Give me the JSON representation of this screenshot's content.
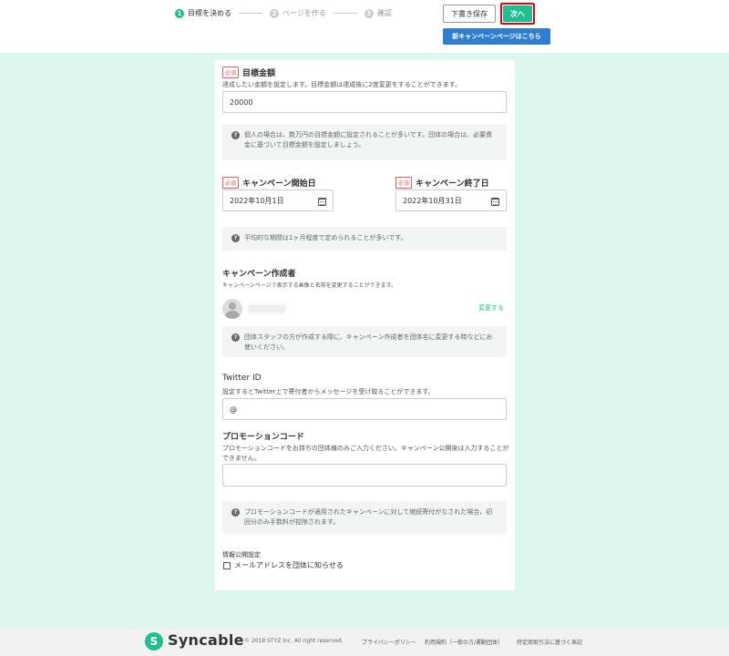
{
  "header": {
    "steps": [
      {
        "num": "1",
        "label": "目標を決める"
      },
      {
        "num": "2",
        "label": "ページを作る"
      },
      {
        "num": "3",
        "label": "確認"
      }
    ],
    "draft_label": "下書き保存",
    "next_label": "次へ",
    "new_campaign_label": "新キャンペーンページはこちら"
  },
  "form": {
    "required_badge": "必須",
    "goal": {
      "label": "目標金額",
      "description": "達成したい金額を設定します。目標金額は達成後に2度変更をすることができます。",
      "value": "20000",
      "hint": "個人の場合は、数万円の目標金額に設定されることが多いです。団体の場合は、必要資金に基づいて目標金額を設定しましょう。"
    },
    "start_date": {
      "label": "キャンペーン開始日",
      "value": "2022年10月1日"
    },
    "end_date": {
      "label": "キャンペーン終了日",
      "value": "2022年10月31日"
    },
    "period_hint": "平均的な期間は1ヶ月程度で定められることが多いです。",
    "creator": {
      "title": "キャンペーン作成者",
      "description": "キャンペーンページで表示する画像と名前を変更することができます。",
      "change_link": "変更する",
      "hint": "団体スタッフの方が作成する際に、キャンペーン作成者を団体名に変更する時などにお使いください。"
    },
    "twitter": {
      "title": "Twitter ID",
      "description": "設定するとTwitter上で寄付者からメッセージを受け取ることができます。",
      "value": "@"
    },
    "promo": {
      "title": "プロモーションコード",
      "description": "プロモーションコードをお持ちの団体様のみご入力ください。キャンペーン公開後は入力することができません。",
      "value": "",
      "hint": "プロモーションコードが適用されたキャンペーンに対して継続寄付がなされた場合、初回分のみ手数料が控除されます。"
    },
    "privacy": {
      "title": "情報公開設定",
      "checkbox_label": "メールアドレスを団体に知らせる",
      "checked": false
    }
  },
  "footer": {
    "logo_mark": "S",
    "logo_text": "Syncable",
    "copyright": "© 2018 STYZ Inc. All right reserved.",
    "links": [
      "プライバシーポリシー",
      "利用規約（一般の方/運動団体）",
      "特定商取引法に基づく表記"
    ]
  },
  "colors": {
    "brand_green": "#1fbf8f",
    "page_background": "#ddf7ef",
    "link_blue": "#2f7fd1",
    "highlight_red": "#e60012"
  }
}
